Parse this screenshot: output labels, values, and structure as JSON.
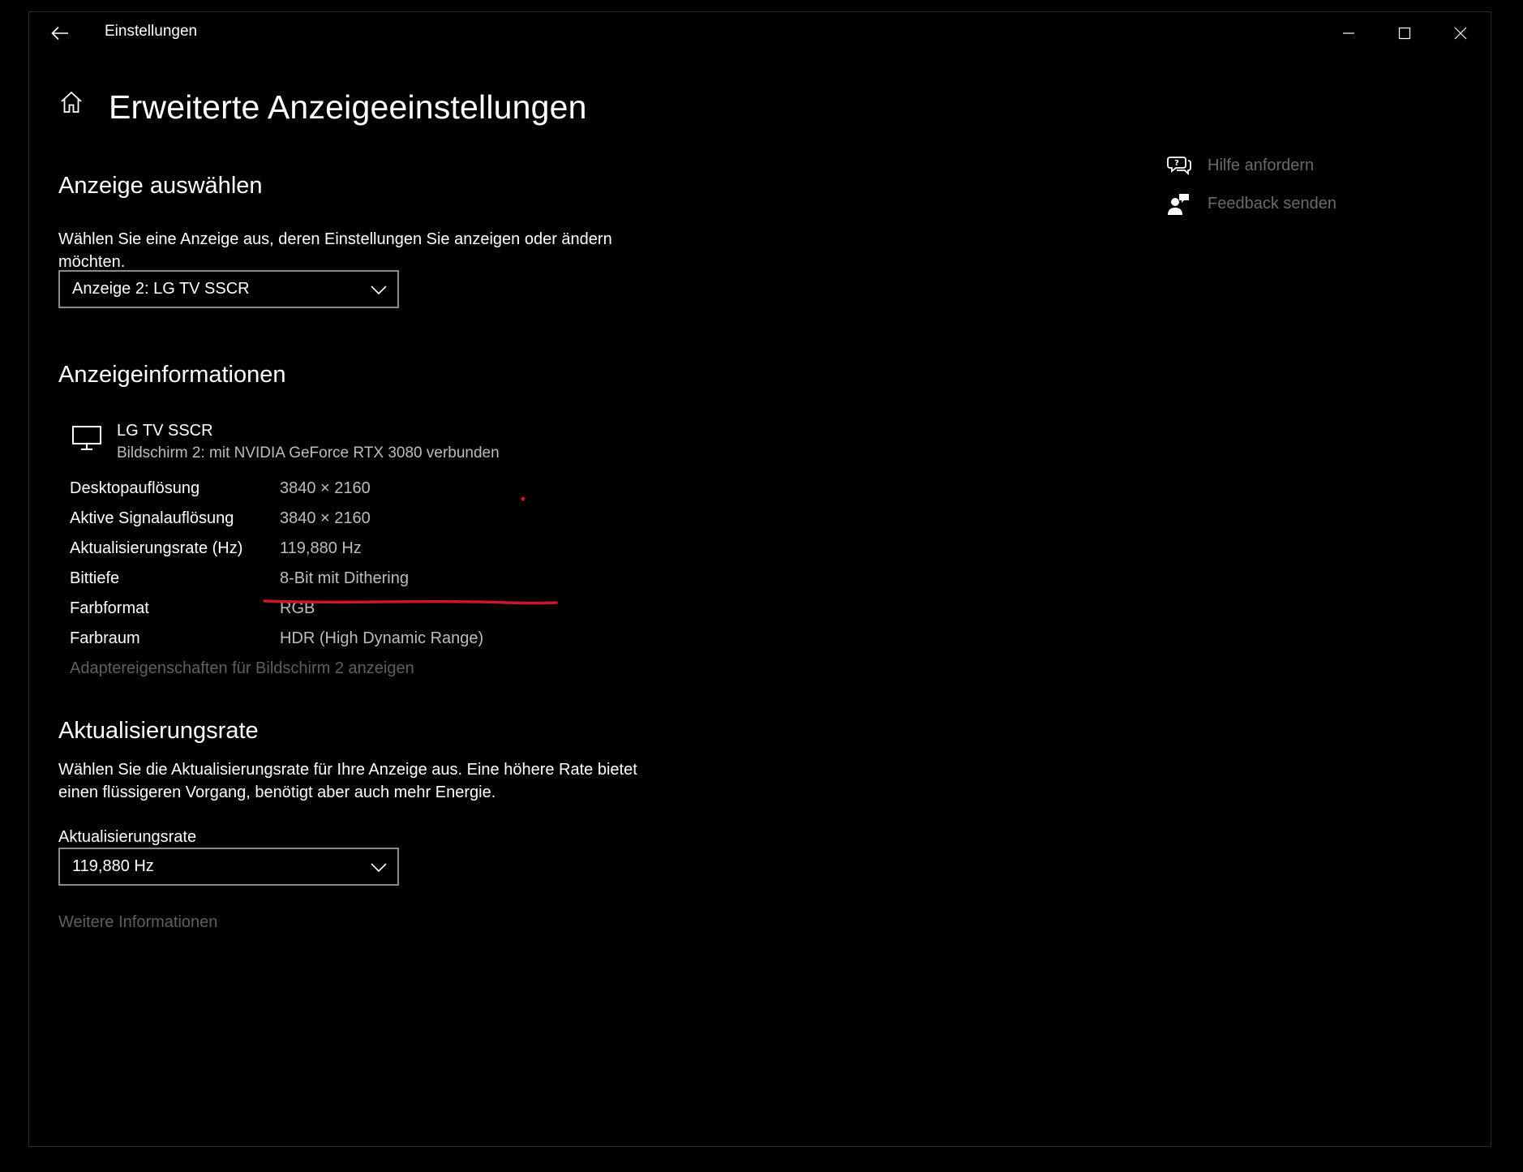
{
  "window": {
    "app_title": "Einstellungen"
  },
  "page": {
    "title": "Erweiterte Anzeigeeinstellungen"
  },
  "select_display": {
    "heading": "Anzeige auswählen",
    "description": "Wählen Sie eine Anzeige aus, deren Einstellungen Sie anzeigen oder ändern möchten.",
    "selected_value": "Anzeige 2: LG TV SSCR"
  },
  "display_info": {
    "heading": "Anzeigeinformationen",
    "monitor_name": "LG TV SSCR",
    "monitor_subtitle": "Bildschirm 2: mit NVIDIA GeForce RTX 3080 verbunden",
    "rows": [
      {
        "label": "Desktopauflösung",
        "value": "3840 × 2160"
      },
      {
        "label": "Aktive Signalauflösung",
        "value": "3840 × 2160"
      },
      {
        "label": "Aktualisierungsrate (Hz)",
        "value": "119,880 Hz"
      },
      {
        "label": "Bittiefe",
        "value": "8-Bit mit Dithering"
      },
      {
        "label": "Farbformat",
        "value": "RGB"
      },
      {
        "label": "Farbraum",
        "value": "HDR (High Dynamic Range)"
      }
    ],
    "adapter_link": "Adaptereigenschaften für Bildschirm 2 anzeigen"
  },
  "refresh_rate": {
    "heading": "Aktualisierungsrate",
    "description": "Wählen Sie die Aktualisierungsrate für Ihre Anzeige aus. Eine höhere Rate bietet einen flüssigeren Vorgang, benötigt aber auch mehr Energie.",
    "field_label": "Aktualisierungsrate",
    "selected_value": "119,880 Hz",
    "more_info_link": "Weitere Informationen"
  },
  "side_links": {
    "help": "Hilfe anfordern",
    "feedback": "Feedback senden"
  },
  "colors": {
    "background": "#000000",
    "annotation_red": "#d0142c"
  },
  "icons": {
    "back": "back-arrow-icon",
    "home": "home-icon",
    "monitor": "monitor-icon",
    "chevron": "chevron-down-icon",
    "help": "help-chat-icon",
    "feedback": "feedback-person-icon"
  }
}
